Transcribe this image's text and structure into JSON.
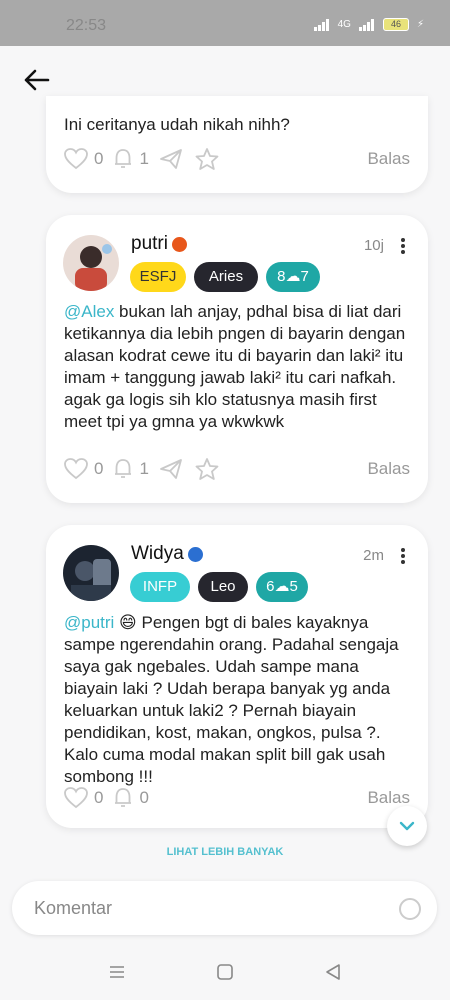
{
  "status_bar": {
    "time": "22:53",
    "network": "4G",
    "battery": "46"
  },
  "comments": [
    {
      "body": "Ini ceritanya udah nikah nihh?",
      "likes": "0",
      "notifs": "1",
      "reply_label": "Balas"
    },
    {
      "user": "putri",
      "user_dot_color": "#e8571b",
      "time": "10j",
      "badges": [
        "ESFJ",
        "Aries",
        "8☁7"
      ],
      "mention": "@Alex",
      "body": " bukan lah anjay, pdhal bisa di liat dari ketikannya dia lebih pngen di bayarin dengan alasan kodrat cewe itu di bayarin dan laki² itu imam + tanggung jawab laki² itu cari nafkah. agak ga logis sih klo statusnya masih first meet tpi ya gmna ya wkwkwk",
      "likes": "0",
      "notifs": "1",
      "reply_label": "Balas"
    },
    {
      "user": "Widya",
      "user_dot_color": "#2b6fd1",
      "time": "2m",
      "badges": [
        "INFP",
        "Leo",
        "6☁5"
      ],
      "mention": "@putri",
      "body": " 😄 Pengen bgt di bales kayaknya sampe ngerendahin orang. Padahal sengaja saya gak ngebales. Udah sampe mana biayain laki ? Udah berapa banyak yg anda keluarkan untuk laki2 ? Pernah biayain pendidikan, kost, makan, ongkos, pulsa ?. Kalo cuma modal makan split bill gak usah sombong !!!",
      "likes": "0",
      "notifs": "0",
      "reply_label": "Balas"
    }
  ],
  "load_more_label": "LIHAT LEBIH BANYAK",
  "composer": {
    "placeholder": "Komentar"
  },
  "colors": {
    "accent": "#3bb6c9",
    "yellow": "#ffd81a",
    "dark": "#26262e",
    "teal": "#1fa7a5"
  }
}
